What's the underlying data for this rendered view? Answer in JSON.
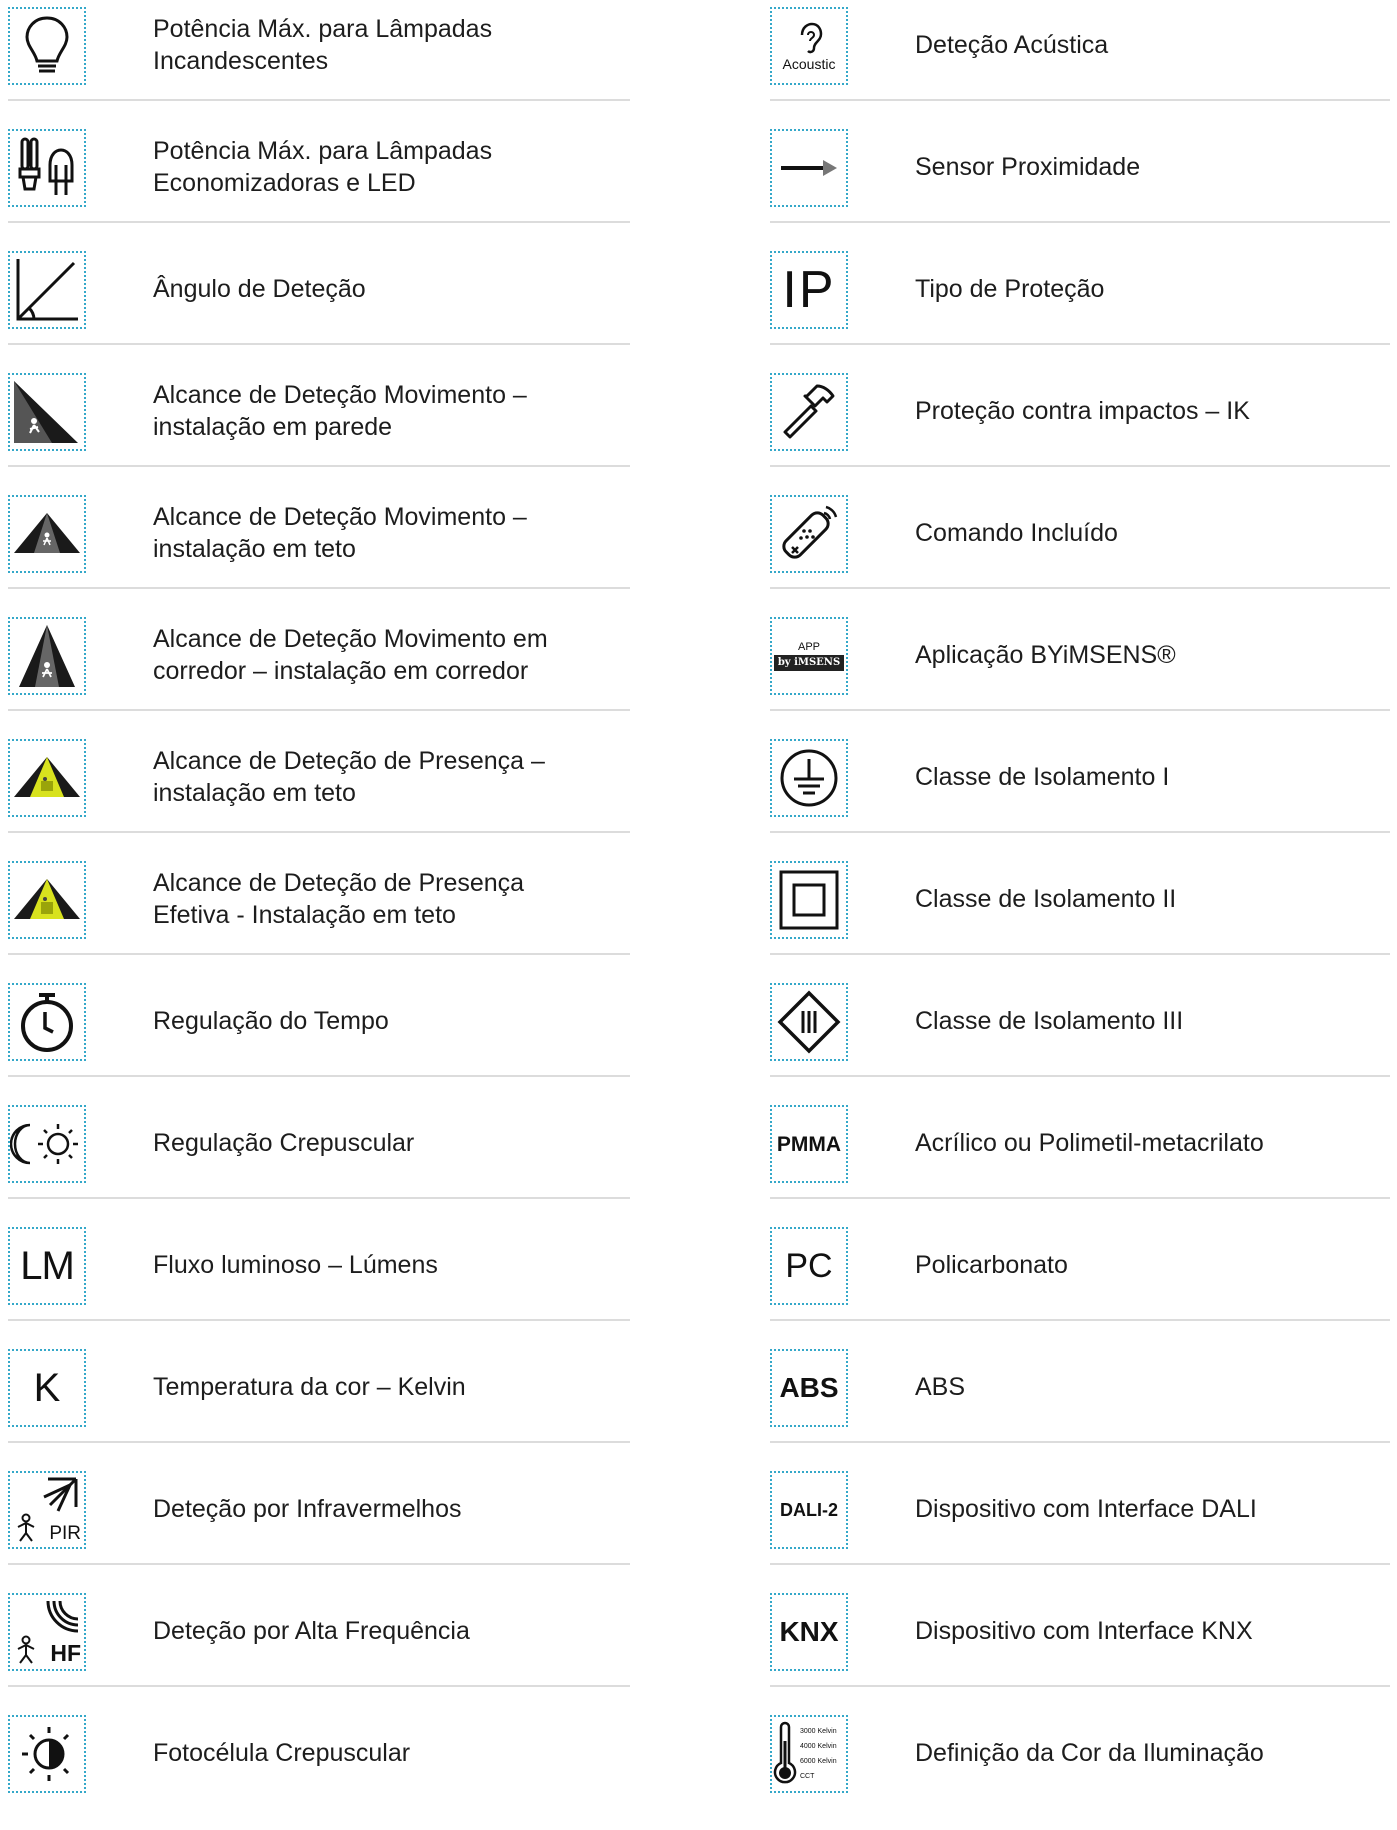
{
  "left_column": [
    {
      "icon": "lightbulb-icon",
      "lines": [
        "Potência Máx. para Lâmpadas",
        "Incandescentes"
      ]
    },
    {
      "icon": "energy-saving-lamps-icon",
      "lines": [
        "Potência Máx. para Lâmpadas",
        "Economizadoras e LED"
      ]
    },
    {
      "icon": "detection-angle-icon",
      "lines": [
        "Ângulo de Deteção"
      ]
    },
    {
      "icon": "wall-motion-range-icon",
      "lines": [
        "Alcance de Deteção Movimento –",
        "instalação em parede"
      ]
    },
    {
      "icon": "ceiling-motion-range-icon",
      "lines": [
        "Alcance de Deteção Movimento –",
        "instalação em teto"
      ]
    },
    {
      "icon": "corridor-motion-range-icon",
      "lines": [
        "Alcance de Deteção Movimento em",
        "corredor  – instalação em corredor"
      ]
    },
    {
      "icon": "ceiling-presence-range-icon",
      "lines": [
        "Alcance de Deteção de Presença –",
        "instalação em teto"
      ]
    },
    {
      "icon": "effective-presence-range-icon",
      "lines": [
        "Alcance de Deteção de Presença",
        "Efetiva - Instalação em teto"
      ]
    },
    {
      "icon": "timer-icon",
      "lines": [
        "Regulação do Tempo"
      ]
    },
    {
      "icon": "moon-sun-icon",
      "lines": [
        "Regulação Crepuscular"
      ]
    },
    {
      "icon": "lumen-icon",
      "icon_text": "LM",
      "lines": [
        "Fluxo luminoso – Lúmens"
      ]
    },
    {
      "icon": "kelvin-icon",
      "icon_text": "K",
      "lines": [
        "Temperatura da cor – Kelvin"
      ]
    },
    {
      "icon": "pir-sensor-icon",
      "icon_text": "PIR",
      "lines": [
        "Deteção por Infravermelhos"
      ]
    },
    {
      "icon": "hf-sensor-icon",
      "icon_text": "HF",
      "lines": [
        "Deteção por Alta Frequência"
      ]
    },
    {
      "icon": "photocell-icon",
      "lines": [
        "Fotocélula Crepuscular"
      ]
    }
  ],
  "right_column": [
    {
      "icon": "ear-icon",
      "icon_text": "Acoustic",
      "lines": [
        "Deteção Acústica"
      ]
    },
    {
      "icon": "proximity-arrow-icon",
      "lines": [
        "Sensor Proximidade"
      ]
    },
    {
      "icon": "ip-rating-icon",
      "icon_text": "IP",
      "lines": [
        "Tipo de Proteção"
      ]
    },
    {
      "icon": "hammer-icon",
      "lines": [
        "Proteção contra impactos – IK"
      ]
    },
    {
      "icon": "remote-control-icon",
      "lines": [
        "Comando Incluído"
      ]
    },
    {
      "icon": "app-icon",
      "icon_text": "APP",
      "icon_badge": "by iMSENS",
      "lines": [
        "Aplicação BYiMSENS®"
      ]
    },
    {
      "icon": "earth-ground-icon",
      "lines": [
        "Classe de Isolamento I"
      ]
    },
    {
      "icon": "double-square-icon",
      "lines": [
        "Classe de Isolamento II"
      ]
    },
    {
      "icon": "diamond-class-three-icon",
      "lines": [
        "Classe de Isolamento III"
      ]
    },
    {
      "icon": "pmma-icon",
      "icon_text": "PMMA",
      "lines": [
        "Acrílico ou Polimetil-metacrilato"
      ]
    },
    {
      "icon": "pc-icon",
      "icon_text": "PC",
      "lines": [
        "Policarbonato"
      ]
    },
    {
      "icon": "abs-icon",
      "icon_text": "ABS",
      "lines": [
        "ABS"
      ]
    },
    {
      "icon": "dali-icon",
      "icon_text": "DALI-2",
      "lines": [
        "Dispositivo com Interface DALI"
      ]
    },
    {
      "icon": "knx-icon",
      "icon_text": "KNX",
      "lines": [
        "Dispositivo com Interface KNX"
      ]
    },
    {
      "icon": "thermometer-icon",
      "icon_lines": [
        "3000 Kelvin",
        "4000 Kelvin",
        "6000 Kelvin",
        "CCT"
      ],
      "lines": [
        "Definição da Cor da Iluminação"
      ]
    }
  ],
  "colors": {
    "icon_border": "#35a8c9",
    "separator": "#dcdcdc",
    "presence_yellow": "#d8e21e"
  }
}
